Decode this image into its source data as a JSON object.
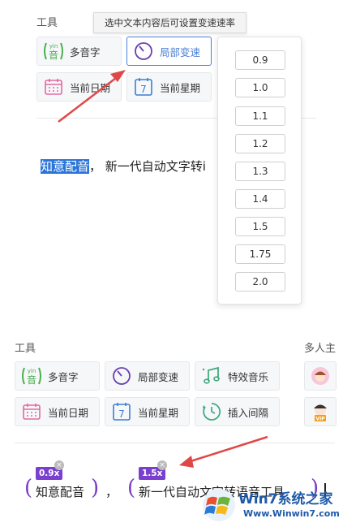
{
  "top": {
    "section_label": "工具",
    "tooltip": "选中文本内容后可设置变速速率",
    "tools": {
      "polyphone": "多音字",
      "local_speed": "局部变速",
      "current_date": "当前日期",
      "current_week": "当前星期"
    },
    "rate_options": [
      "0.9",
      "1.0",
      "1.1",
      "1.2",
      "1.3",
      "1.4",
      "1.5",
      "1.75",
      "2.0"
    ],
    "editor": {
      "selected_text": "知意配音",
      "rest_text": "，  新一代自动文字转i"
    }
  },
  "bottom": {
    "section_label": "工具",
    "side_label": "多人主",
    "tools": {
      "polyphone": "多音字",
      "local_speed": "局部变速",
      "effects_music": "特效音乐",
      "current_date": "当前日期",
      "current_week": "当前星期",
      "insert_interval": "插入间隔"
    },
    "editor": {
      "segment1_badge": "0.9x",
      "segment1_text": "知意配音",
      "comma": "，",
      "segment2_badge": "1.5x",
      "segment2_text": "新一代自动文字转语音工具"
    }
  },
  "icons": {
    "polyphone_glyph": "音",
    "polyphone_small": "yin",
    "calendar_number": "7",
    "vip": "VIP"
  },
  "watermark": {
    "line1": "Win7系统之家",
    "line2": "Www.Winwin7.com"
  },
  "colors": {
    "accent_blue": "#4a7fd6",
    "speed_purple": "#7b3fd0",
    "polyphone_green": "#4caf50",
    "calendar_pink": "#e26aa0",
    "arrow_red": "#e04848"
  }
}
